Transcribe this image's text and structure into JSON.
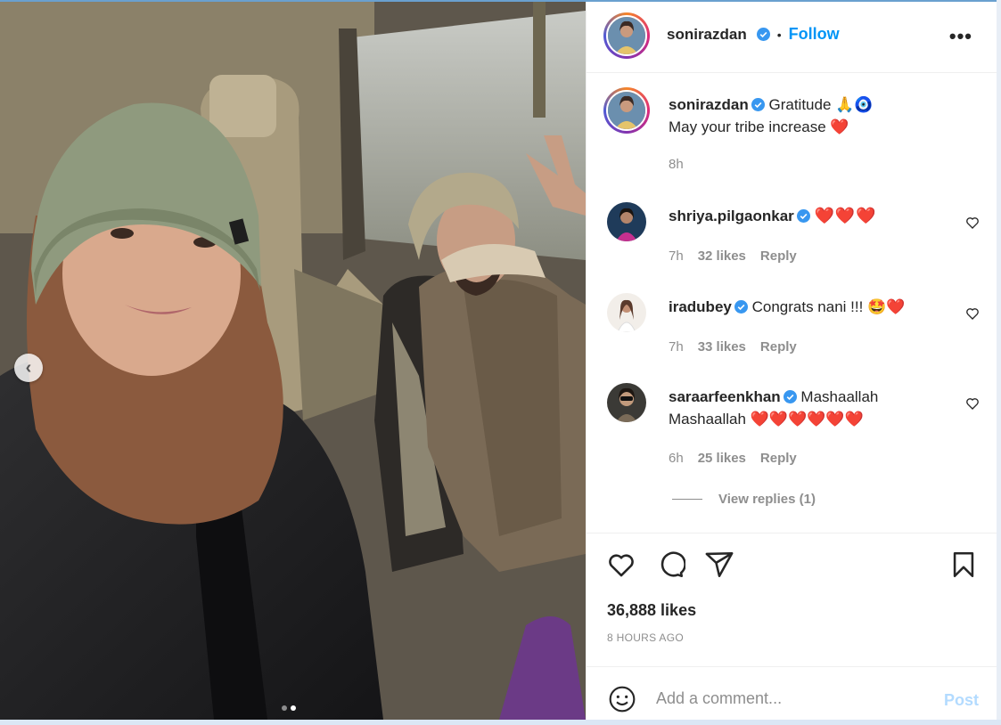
{
  "post": {
    "author": "sonirazdan",
    "follow_label": "Follow",
    "more_label": "•••",
    "bullet": "•",
    "caption_line1": "Gratitude 🙏🧿",
    "caption_line2": "May your tribe increase ❤️",
    "caption_time": "8h",
    "likes": "36,888 likes",
    "posted_ago": "8 HOURS AGO",
    "carousel": {
      "current": 2,
      "total": 2
    }
  },
  "comments": [
    {
      "user": "shriya.pilgaonkar",
      "text": "❤️❤️❤️",
      "time": "7h",
      "likes": "32 likes",
      "reply": "Reply"
    },
    {
      "user": "iradubey",
      "text": "Congrats nani !!! 🤩❤️",
      "time": "7h",
      "likes": "33 likes",
      "reply": "Reply"
    },
    {
      "user": "saraarfeenkhan",
      "text": "Mashaallah",
      "text2": "Mashaallah ❤️❤️❤️❤️❤️❤️",
      "time": "6h",
      "likes": "25 likes",
      "reply": "Reply"
    }
  ],
  "view_replies": "View replies (1)",
  "comment_box": {
    "placeholder": "Add a comment...",
    "post_label": "Post"
  },
  "colors": {
    "accent": "#0095f6",
    "heart": "#e0101b",
    "muted": "#8e8e8e",
    "verified": "#3897f0"
  }
}
